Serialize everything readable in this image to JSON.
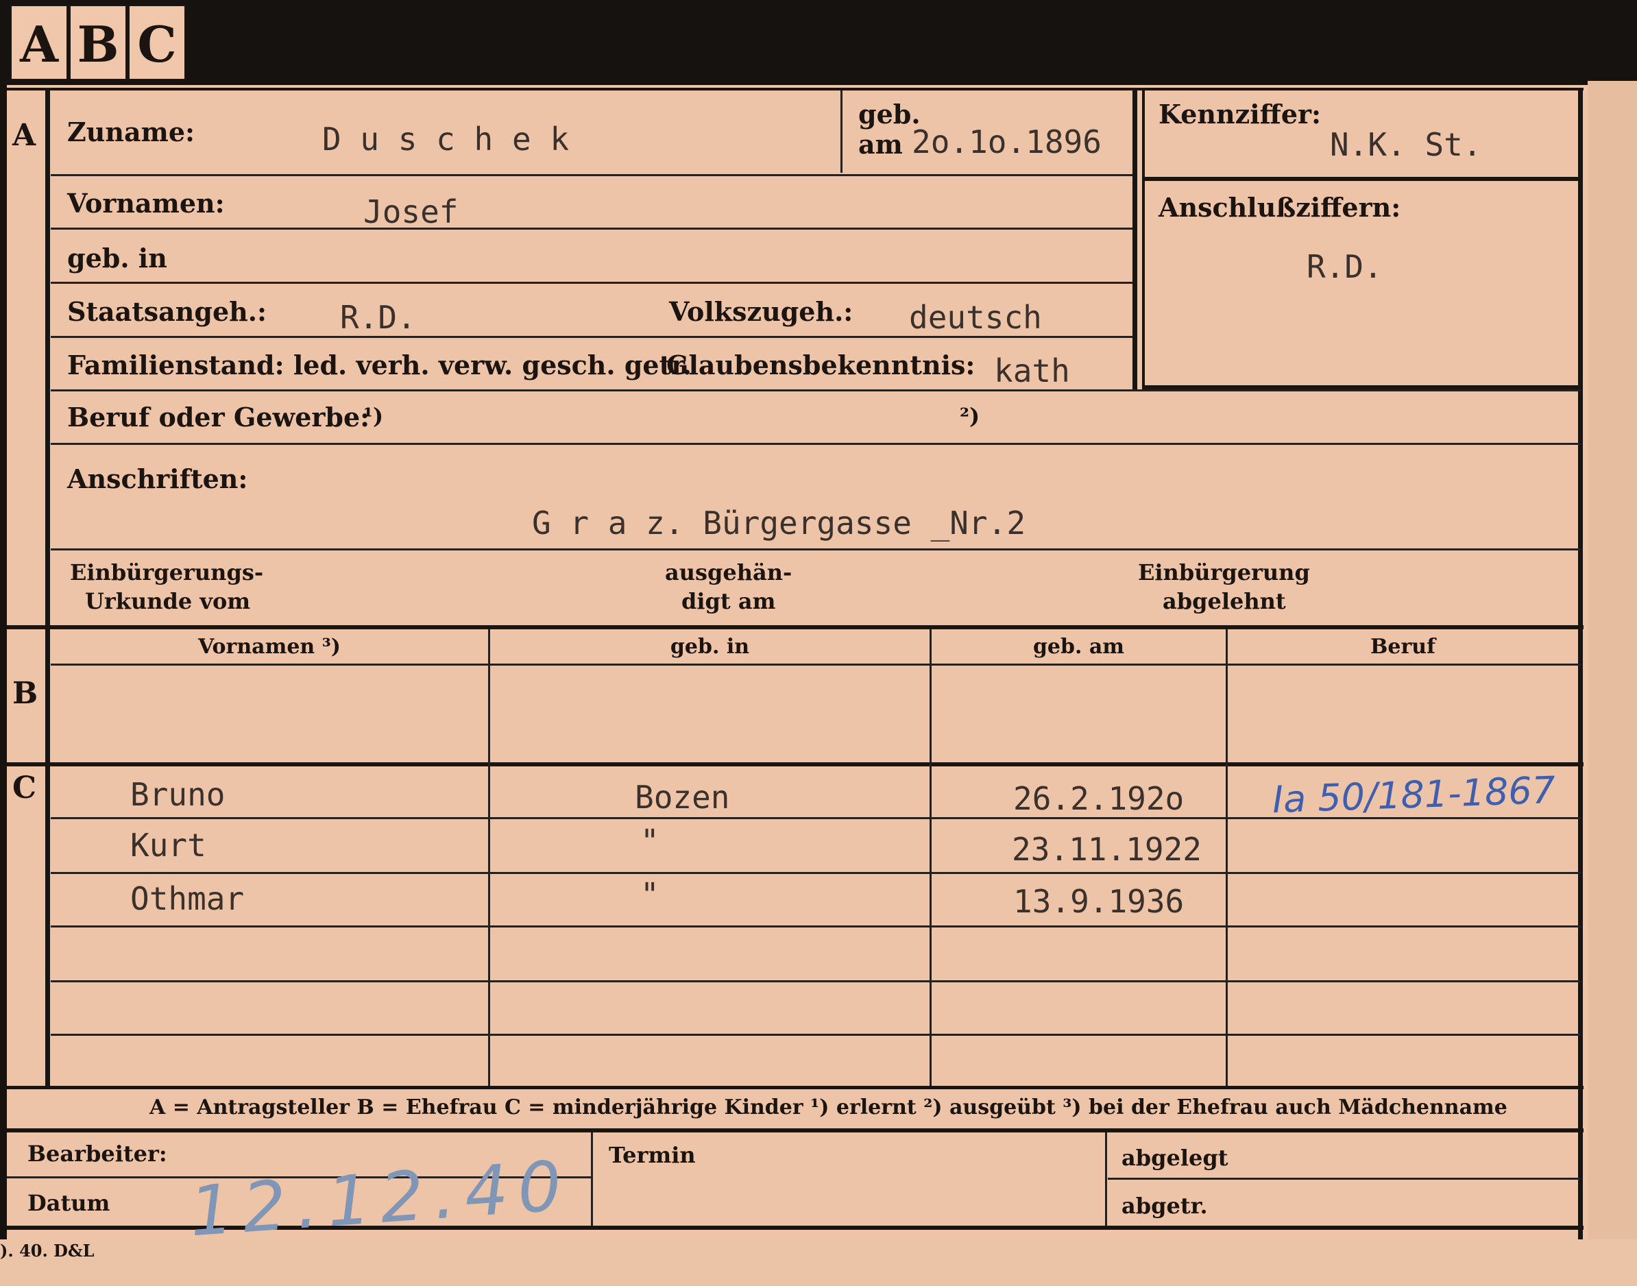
{
  "tabs": [
    "A",
    "B",
    "C"
  ],
  "section_a": {
    "marker": "A",
    "zuname_label": "Zuname:",
    "zuname_value": "D u s c h e k",
    "geb_label": "geb.",
    "geb_am_label": "am",
    "geb_am_value": "2o.1o.1896",
    "kennziffer_label": "Kennziffer:",
    "kennziffer_value": "N.K.   St.",
    "vornamen_label": "Vornamen:",
    "vornamen_value": "Josef",
    "geb_in_label": "geb. in",
    "anschlussziffern_label": "Anschlußziffern:",
    "anschlussziffern_value": "R.D.",
    "staatsangeh_label": "Staatsangeh.:",
    "staatsangeh_value": "R.D.",
    "volkszugeh_label": "Volkszugeh.:",
    "volkszugeh_value": "deutsch",
    "familienstand_label": "Familienstand: led. verh. verw. gesch. getr.",
    "glaubens_label": "Glaubensbekenntnis:",
    "glaubens_value": "kath",
    "beruf_label": "Beruf oder Gewerbe:",
    "beruf_note1": "¹)",
    "beruf_note2": "²)",
    "anschriften_label": "Anschriften:",
    "anschriften_value": "G r a z. Bürgergasse _Nr.2",
    "einb_urkunde_line1": "Einbürgerungs-",
    "einb_urkunde_line2": "Urkunde vom",
    "ausgehaendigt_line1": "ausgehän-",
    "ausgehaendigt_line2": "digt am",
    "einb_abgelehnt_line1": "Einbürgerung",
    "einb_abgelehnt_line2": "abgelehnt"
  },
  "section_b": {
    "marker": "B",
    "columns": [
      "Vornamen ³)",
      "geb. in",
      "geb. am",
      "Beruf"
    ]
  },
  "section_c": {
    "marker": "C",
    "rows": [
      {
        "name": "Bruno",
        "place": "Bozen",
        "date": "26.2.192o"
      },
      {
        "name": "Kurt",
        "place": "\"",
        "date": "23.11.1922"
      },
      {
        "name": "Othmar",
        "place": "\"",
        "date": "13.9.1936"
      }
    ],
    "handwritten_note": "Ia 50/181-1867"
  },
  "legend": "A = Antragsteller   B = Ehefrau   C = minderjährige Kinder   ¹) erlernt   ²) ausgeübt   ³) bei der Ehefrau auch Mädchenname",
  "footer": {
    "bearbeiter_label": "Bearbeiter:",
    "datum_label": "Datum",
    "datum_value": "12.12.40",
    "termin_label": "Termin",
    "abgelegt_label": "abgelegt",
    "abgetr_label": "abgetr."
  },
  "imprint": "). 40. D&L"
}
